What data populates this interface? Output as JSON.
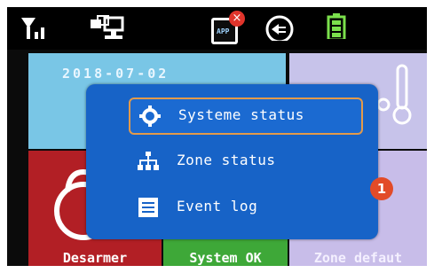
{
  "status_bar": {
    "icons": [
      "signal-icon",
      "network-icon",
      "app-icon",
      "power-plug-icon",
      "battery-icon"
    ],
    "app_icon_text": "APP"
  },
  "tiles": {
    "top_left": {
      "date": "2018-07-02",
      "color": "#79c6e6"
    },
    "top_right": {
      "color": "#c7c3ea"
    },
    "bottom_left": {
      "label": "Desarmer",
      "color": "#b21f25"
    },
    "bottom_middle": {
      "label": "System OK",
      "color": "#3ea838"
    },
    "bottom_right": {
      "label": "Zone defaut",
      "color": "#c8bde9",
      "badge_count": "1"
    }
  },
  "menu": {
    "items": [
      {
        "label": "Systeme status",
        "icon": "gear-icon",
        "selected": true
      },
      {
        "label": "Zone status",
        "icon": "hierarchy-icon",
        "selected": false
      },
      {
        "label": "Event log",
        "icon": "list-icon",
        "selected": false
      }
    ]
  },
  "colors": {
    "menu_bg": "#1763c7",
    "selection_border": "#e39a4a",
    "status_bar_bg": "#000000"
  }
}
